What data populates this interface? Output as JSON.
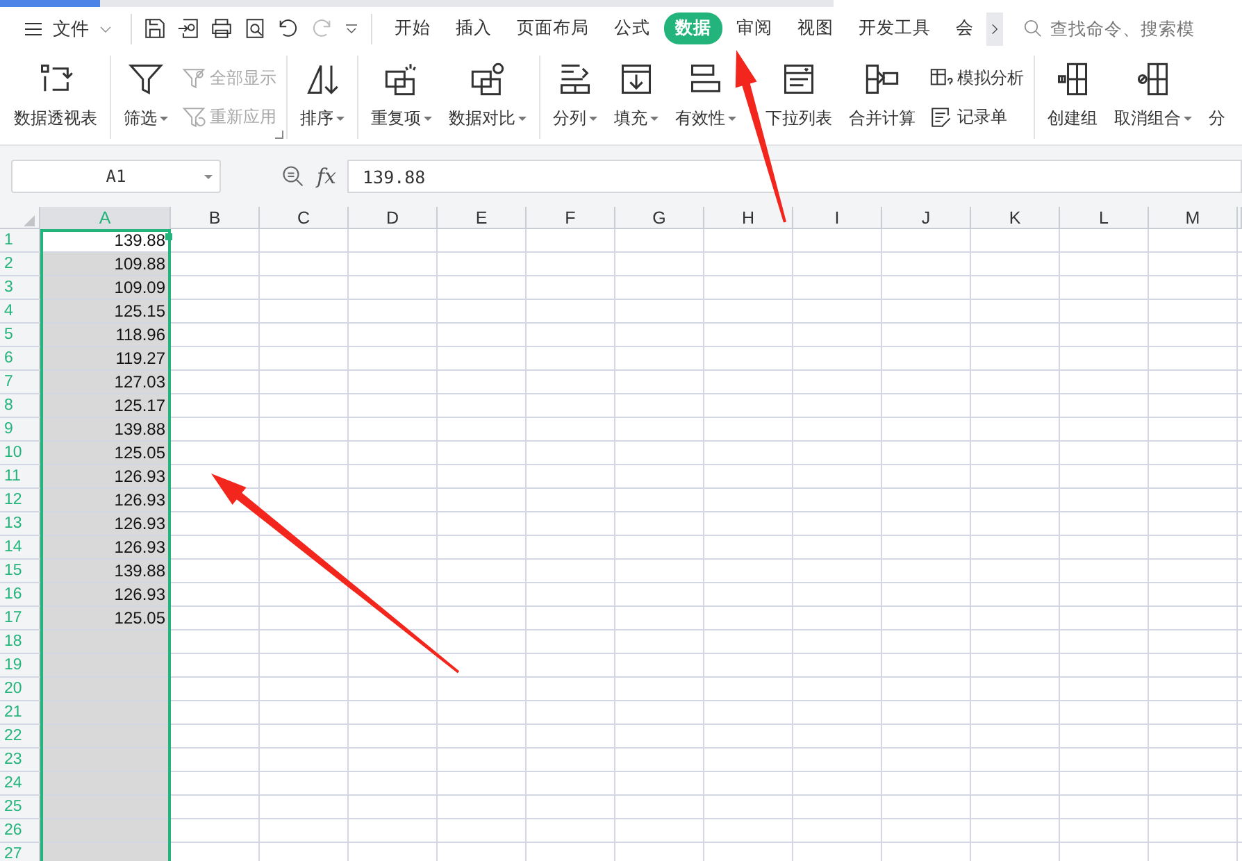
{
  "file_menu": {
    "label": "文件"
  },
  "menu_tabs": [
    {
      "label": "开始",
      "selected": false
    },
    {
      "label": "插入",
      "selected": false
    },
    {
      "label": "页面布局",
      "selected": false
    },
    {
      "label": "公式",
      "selected": false
    },
    {
      "label": "数据",
      "selected": true
    },
    {
      "label": "审阅",
      "selected": false
    },
    {
      "label": "视图",
      "selected": false
    },
    {
      "label": "开发工具",
      "selected": false
    },
    {
      "label": "会",
      "selected": false
    }
  ],
  "search": {
    "placeholder": "查找命令、搜索模"
  },
  "ribbon": {
    "groups": [
      {
        "items": [
          {
            "kind": "large",
            "label": "数据透视表",
            "dropdown": false
          }
        ]
      },
      {
        "launcher": true,
        "items": [
          {
            "kind": "large",
            "label": "筛选",
            "dropdown": true
          },
          {
            "kind": "stack",
            "items": [
              {
                "label": "全部显示",
                "disabled": true
              },
              {
                "label": "重新应用",
                "disabled": true
              }
            ]
          }
        ]
      },
      {
        "items": [
          {
            "kind": "large",
            "label": "排序",
            "dropdown": true
          }
        ]
      },
      {
        "items": [
          {
            "kind": "large",
            "label": "重复项",
            "dropdown": true
          },
          {
            "kind": "large",
            "label": "数据对比",
            "dropdown": true
          }
        ]
      },
      {
        "items": [
          {
            "kind": "large",
            "label": "分列",
            "dropdown": true
          },
          {
            "kind": "large",
            "label": "填充",
            "dropdown": true
          },
          {
            "kind": "large",
            "label": "有效性",
            "dropdown": true
          },
          {
            "kind": "large",
            "label": "下拉列表",
            "dropdown": false
          },
          {
            "kind": "large",
            "label": "合并计算",
            "dropdown": false
          },
          {
            "kind": "stack",
            "items": [
              {
                "label": "模拟分析",
                "disabled": false
              },
              {
                "label": "记录单",
                "disabled": false
              }
            ]
          }
        ]
      },
      {
        "items": [
          {
            "kind": "large",
            "label": "创建组",
            "dropdown": false
          },
          {
            "kind": "large",
            "label": "取消组合",
            "dropdown": true
          },
          {
            "kind": "large",
            "label": "分",
            "dropdown": false
          }
        ]
      }
    ]
  },
  "name_box": {
    "value": "A1"
  },
  "formula_bar": {
    "fx_label": "fx",
    "value": "139.88"
  },
  "columns": [
    {
      "label": "A",
      "selected": true
    },
    {
      "label": "B",
      "selected": false
    },
    {
      "label": "C",
      "selected": false
    },
    {
      "label": "D",
      "selected": false
    },
    {
      "label": "E",
      "selected": false
    },
    {
      "label": "F",
      "selected": false
    },
    {
      "label": "G",
      "selected": false
    },
    {
      "label": "H",
      "selected": false
    },
    {
      "label": "I",
      "selected": false
    },
    {
      "label": "J",
      "selected": false
    },
    {
      "label": "K",
      "selected": false
    },
    {
      "label": "L",
      "selected": false
    },
    {
      "label": "M",
      "selected": false
    }
  ],
  "rows": [
    {
      "number": "1",
      "value": "139.88",
      "selected": true
    },
    {
      "number": "2",
      "value": "109.88",
      "selected": true
    },
    {
      "number": "3",
      "value": "109.09",
      "selected": true
    },
    {
      "number": "4",
      "value": "125.15",
      "selected": true
    },
    {
      "number": "5",
      "value": "118.96",
      "selected": true
    },
    {
      "number": "6",
      "value": "119.27",
      "selected": true
    },
    {
      "number": "7",
      "value": "127.03",
      "selected": true
    },
    {
      "number": "8",
      "value": "125.17",
      "selected": true
    },
    {
      "number": "9",
      "value": "139.88",
      "selected": true
    },
    {
      "number": "10",
      "value": "125.05",
      "selected": true
    },
    {
      "number": "11",
      "value": "126.93",
      "selected": true
    },
    {
      "number": "12",
      "value": "126.93",
      "selected": true
    },
    {
      "number": "13",
      "value": "126.93",
      "selected": true
    },
    {
      "number": "14",
      "value": "126.93",
      "selected": true
    },
    {
      "number": "15",
      "value": "139.88",
      "selected": true
    },
    {
      "number": "16",
      "value": "126.93",
      "selected": true
    },
    {
      "number": "17",
      "value": "125.05",
      "selected": true
    },
    {
      "number": "18",
      "selected": true
    },
    {
      "number": "19",
      "selected": true
    },
    {
      "number": "20",
      "selected": true
    },
    {
      "number": "21",
      "selected": true
    },
    {
      "number": "22",
      "selected": true
    },
    {
      "number": "23",
      "selected": true
    },
    {
      "number": "24",
      "selected": true
    },
    {
      "number": "25",
      "selected": true
    },
    {
      "number": "26",
      "selected": true
    },
    {
      "number": "27",
      "selected": true
    }
  ],
  "annotations": [
    {
      "kind": "arrow"
    },
    {
      "kind": "arrow"
    }
  ]
}
